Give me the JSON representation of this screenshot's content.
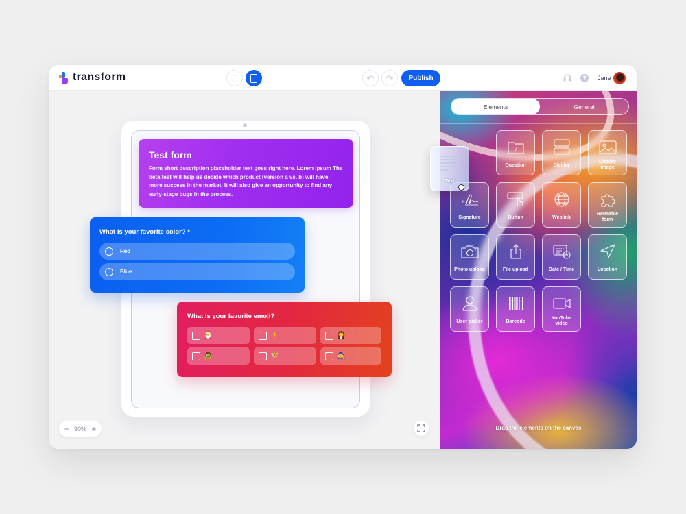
{
  "app": {
    "brand": "transform",
    "colors": {
      "accent": "#0f5ff0",
      "header_card": "#a02df0",
      "color_question_card": "#0c6cf4",
      "emoji_question_card": "#e3283f"
    }
  },
  "header": {
    "device_toggles": [
      {
        "name": "phone",
        "icon": "phone-icon",
        "active": false
      },
      {
        "name": "tablet",
        "icon": "tablet-icon",
        "active": true
      }
    ],
    "undo_icon": "↶",
    "redo_icon": "↷",
    "publish_label": "Publish",
    "support_icon": "headset-icon",
    "help_icon": "?",
    "user_name": "Jane"
  },
  "canvas": {
    "form": {
      "title": "Test form",
      "description": "Form short description placeholder text goes right here. Lorem Ipsum The beta test will help us decide which product (version a vs. b) will have more success in the market. It will also give an opportunity to find any early-stage bugs in the process."
    },
    "color_question": {
      "label": "What is your favorite color? *",
      "options": [
        "Red",
        "Blue"
      ]
    },
    "emoji_question": {
      "label": "What is your favorite emoji?",
      "options": [
        "🎅",
        "🧜",
        "🧛",
        "🧟",
        "🧚",
        "🧙"
      ]
    },
    "zoom": {
      "minus": "−",
      "level": "90%",
      "plus": "+"
    },
    "fullscreen_icon": "fullscreen-icon"
  },
  "panel": {
    "tabs": [
      {
        "label": "Elements",
        "active": true
      },
      {
        "label": "General",
        "active": false
      }
    ],
    "dragging_element": {
      "label": "Text",
      "icon": "text-lines-icon"
    },
    "elements": [
      {
        "label": "Question",
        "icon": "question-folder-icon"
      },
      {
        "label": "Divider",
        "icon": "divider-icon"
      },
      {
        "label": "Display image",
        "icon": "image-icon"
      },
      {
        "label": "Signature",
        "icon": "signature-icon"
      },
      {
        "label": "Button",
        "icon": "button-click-icon"
      },
      {
        "label": "Weblink",
        "icon": "globe-icon"
      },
      {
        "label": "Reusable form",
        "icon": "puzzle-icon"
      },
      {
        "label": "Photo upload",
        "icon": "camera-icon"
      },
      {
        "label": "File upload",
        "icon": "upload-icon"
      },
      {
        "label": "Date / Time",
        "icon": "calendar-clock-icon"
      },
      {
        "label": "Location",
        "icon": "location-arrow-icon"
      },
      {
        "label": "User picker",
        "icon": "user-icon"
      },
      {
        "label": "Barcode",
        "icon": "barcode-icon"
      },
      {
        "label": "YouTube video",
        "icon": "video-camera-icon"
      }
    ],
    "hint": "Drag the elements on the canvas"
  }
}
